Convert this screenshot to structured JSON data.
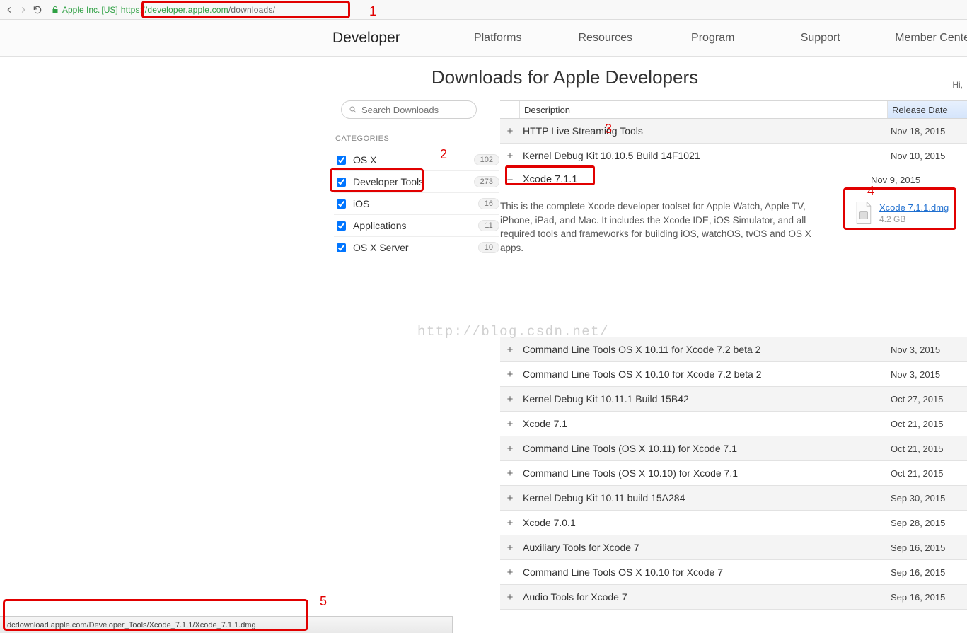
{
  "browser": {
    "identity": "Apple Inc.",
    "region": "[US]",
    "url_host": "https://developer.apple.com",
    "url_path": "/downloads/"
  },
  "annotations": {
    "a1": "1",
    "a2": "2",
    "a3": "3",
    "a4": "4",
    "a5": "5"
  },
  "nav": {
    "brand": "Developer",
    "links": [
      "Platforms",
      "Resources",
      "Program",
      "Support",
      "Member Center"
    ]
  },
  "page": {
    "title": "Downloads for Apple Developers",
    "greeting": "Hi,"
  },
  "sidebar": {
    "search_placeholder": "Search Downloads",
    "header": "CATEGORIES",
    "cats": [
      {
        "label": "OS X",
        "count": "102"
      },
      {
        "label": "Developer Tools",
        "count": "273"
      },
      {
        "label": "iOS",
        "count": "16"
      },
      {
        "label": "Applications",
        "count": "11"
      },
      {
        "label": "OS X Server",
        "count": "10"
      }
    ]
  },
  "table": {
    "th_desc": "Description",
    "th_date": "Release Date",
    "rows_top": [
      {
        "t": "HTTP Live Streaming Tools",
        "d": "Nov 18, 2015"
      },
      {
        "t": "Kernel Debug Kit 10.10.5 Build 14F1021",
        "d": "Nov 10, 2015"
      }
    ],
    "expanded": {
      "title": "Xcode 7.1.1",
      "date": "Nov 9, 2015",
      "body": "This is the complete Xcode developer toolset for Apple Watch, Apple TV, iPhone, iPad, and Mac. It includes the Xcode IDE, iOS Simulator, and all required tools and frameworks for building iOS, watchOS, tvOS and OS X apps.",
      "file_name": "Xcode 7.1.1.dmg",
      "file_size": "4.2 GB"
    },
    "rows_bottom": [
      {
        "t": "Command Line Tools OS X 10.11 for Xcode 7.2 beta 2",
        "d": "Nov 3, 2015"
      },
      {
        "t": "Command Line Tools OS X 10.10 for Xcode 7.2 beta 2",
        "d": "Nov 3, 2015"
      },
      {
        "t": "Kernel Debug Kit 10.11.1 Build 15B42",
        "d": "Oct 27, 2015"
      },
      {
        "t": "Xcode 7.1",
        "d": "Oct 21, 2015"
      },
      {
        "t": "Command Line Tools (OS X 10.11) for Xcode 7.1",
        "d": "Oct 21, 2015"
      },
      {
        "t": "Command Line Tools (OS X 10.10) for Xcode 7.1",
        "d": "Oct 21, 2015"
      },
      {
        "t": "Kernel Debug Kit 10.11 build 15A284",
        "d": "Sep 30, 2015"
      },
      {
        "t": "Xcode 7.0.1",
        "d": "Sep 28, 2015"
      },
      {
        "t": "Auxiliary Tools for Xcode 7",
        "d": "Sep 16, 2015"
      },
      {
        "t": "Command Line Tools OS X 10.10 for Xcode 7",
        "d": "Sep 16, 2015"
      },
      {
        "t": "Audio Tools for Xcode 7",
        "d": "Sep 16, 2015"
      }
    ]
  },
  "watermark": "http://blog.csdn.net/",
  "status": {
    "text": "dcdownload.apple.com/Developer_Tools/Xcode_7.1.1/Xcode_7.1.1.dmg"
  }
}
